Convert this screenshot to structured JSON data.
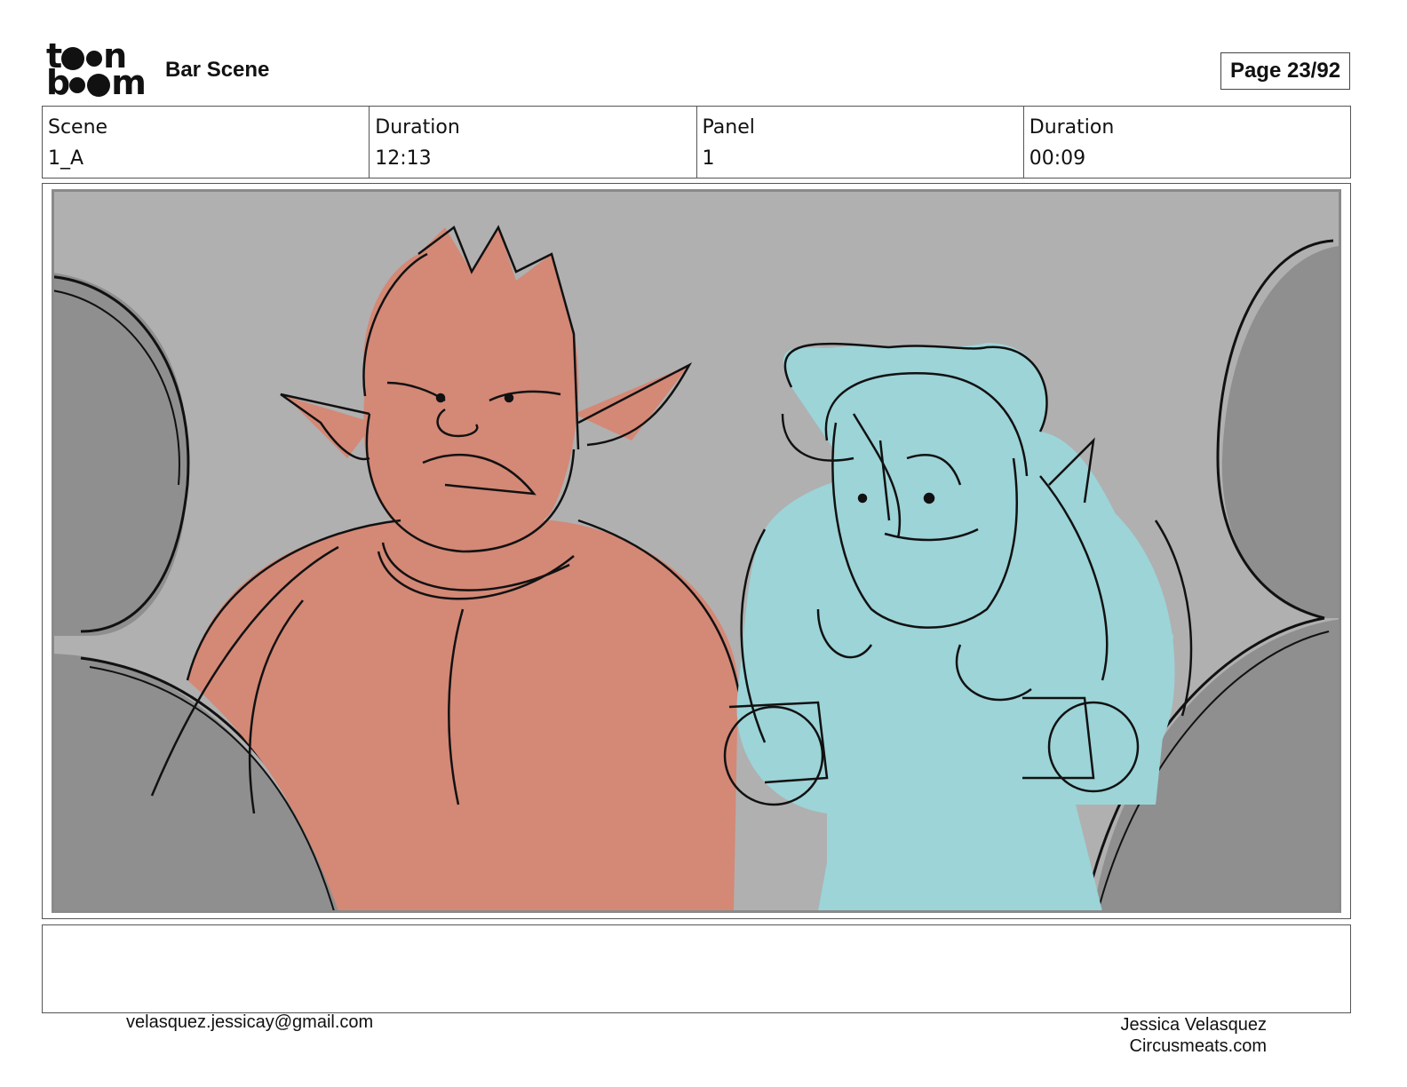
{
  "header": {
    "logo_text_top": "toon",
    "logo_text_bottom": "boom",
    "project_title": "Bar Scene",
    "page_label": "Page 23/92"
  },
  "info": {
    "scene_label": "Scene",
    "scene_value": "1_A",
    "scene_duration_label": "Duration",
    "scene_duration_value": "12:13",
    "panel_label": "Panel",
    "panel_value": "1",
    "panel_duration_label": "Duration",
    "panel_duration_value": "00:09"
  },
  "footer": {
    "email": "velasquez.jessicay@gmail.com",
    "author": "Jessica Velasquez",
    "website": "Circusmeats.com"
  },
  "colors": {
    "background_gray": "#b0b0b0",
    "foreground_dark_gray": "#8f8f8f",
    "character_left_fill": "#d48876",
    "character_right_fill": "#9cd4d8",
    "ink": "#111111"
  }
}
